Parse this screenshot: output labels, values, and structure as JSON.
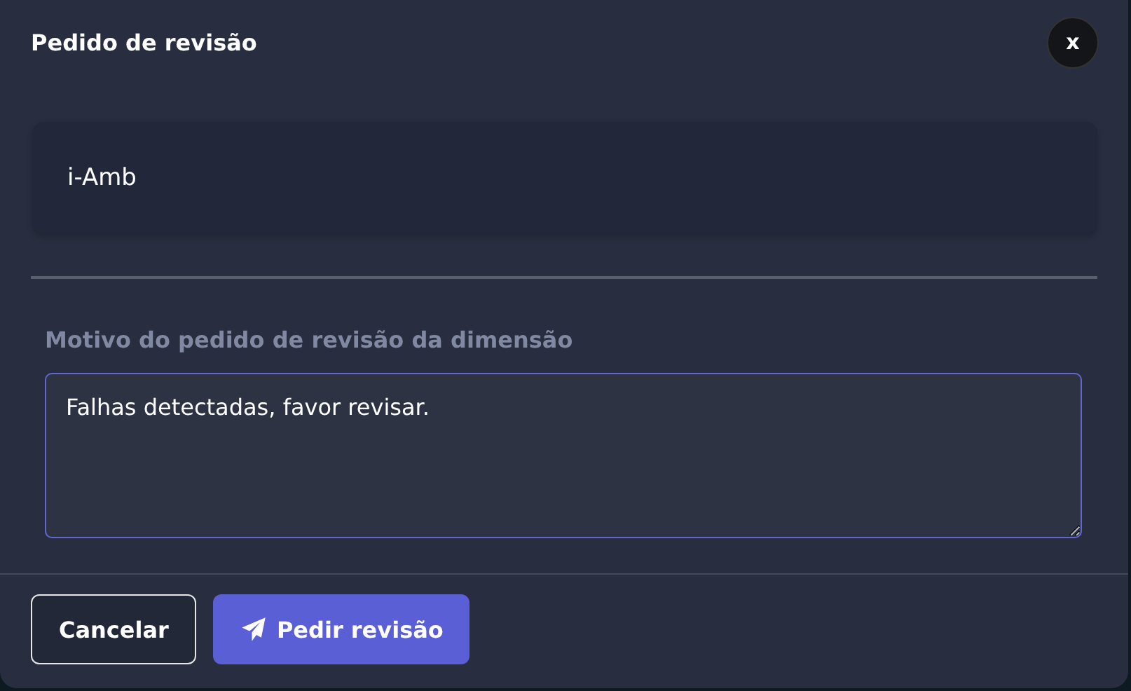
{
  "dialog": {
    "title": "Pedido de revisão",
    "close_label": "x"
  },
  "dimension": {
    "name": "i-Amb"
  },
  "reason": {
    "label": "Motivo do pedido de revisão da dimensão",
    "value": "Falhas detectadas, favor revisar."
  },
  "buttons": [
    {
      "label": "Cancelar",
      "kind": "secondary"
    },
    {
      "label": "Pedir revisão",
      "kind": "primary"
    }
  ]
}
